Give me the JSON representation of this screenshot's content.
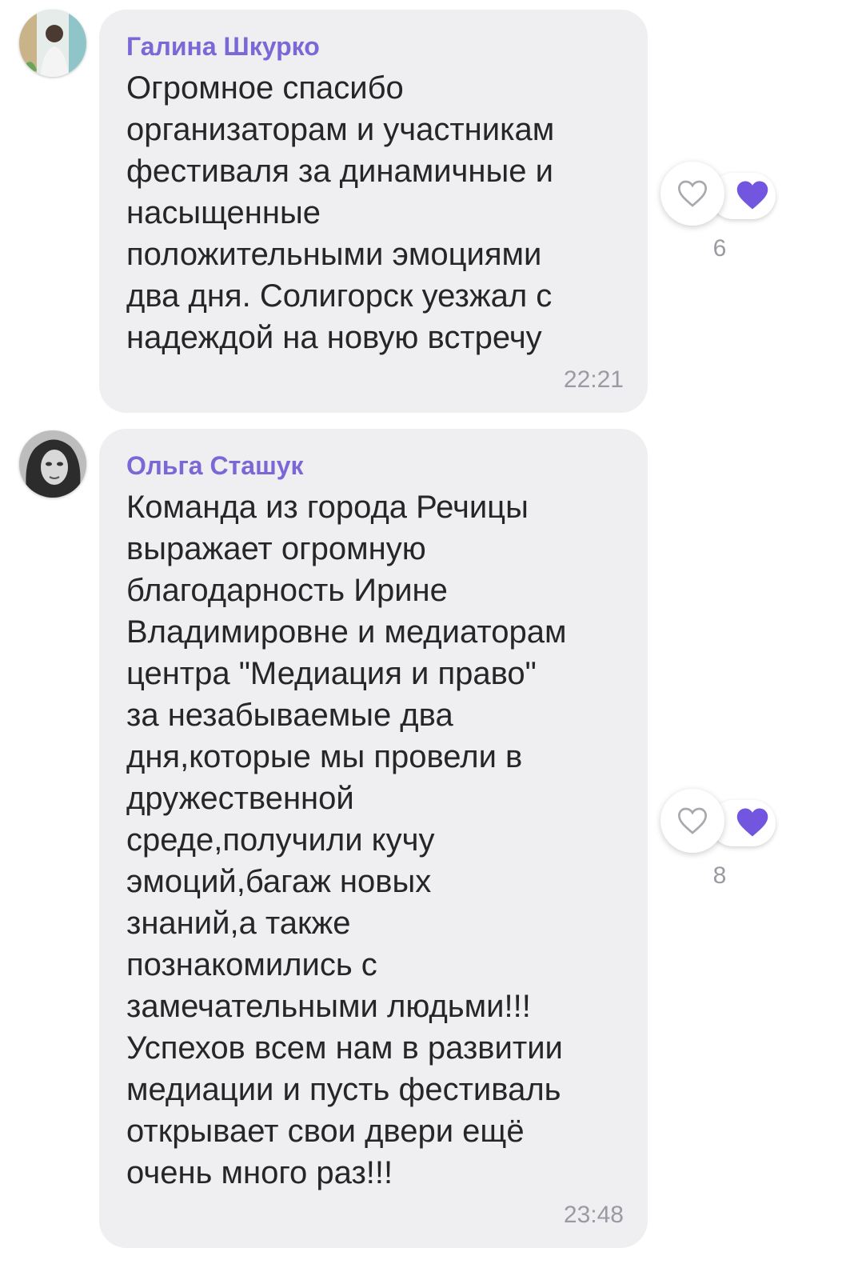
{
  "colors": {
    "accent": "#7b67d6",
    "bubble": "#efeff1",
    "text": "#262629",
    "muted": "#9a9aa2",
    "heart": "#7356e0"
  },
  "messages": [
    {
      "sender": "Галина Шкурко",
      "text": "Огромное спасибо\nорганизаторам и участникам\nфестиваля за динамичные и\nнасыщенные\nположительными эмоциями\nдва дня. Солигорск уезжал с\nнадеждой на новую встречу",
      "time": "22:21",
      "likes": "6",
      "avatar_icon": "user-avatar-icon",
      "like_icon": "heart-outline-icon",
      "reaction_icon": "heart-filled-icon"
    },
    {
      "sender": "Ольга Сташук",
      "text": "Команда из города Речицы\nвыражает огромную\nблагодарность Ирине\nВладимировне и медиаторам\nцентра \"Медиация и право\"\nза незабываемые два\nдня,которые мы провели в\nдружественной\nсреде,получили кучу\nэмоций,багаж новых\nзнаний,а также\nпознакомились с\nзамечательными людьми!!!\nУспехов всем нам в развитии\nмедиации и пусть фестиваль\nоткрывает свои двери ещё\nочень много раз!!!",
      "time": "23:48",
      "likes": "8",
      "avatar_icon": "user-avatar-icon",
      "like_icon": "heart-outline-icon",
      "reaction_icon": "heart-filled-icon"
    }
  ]
}
